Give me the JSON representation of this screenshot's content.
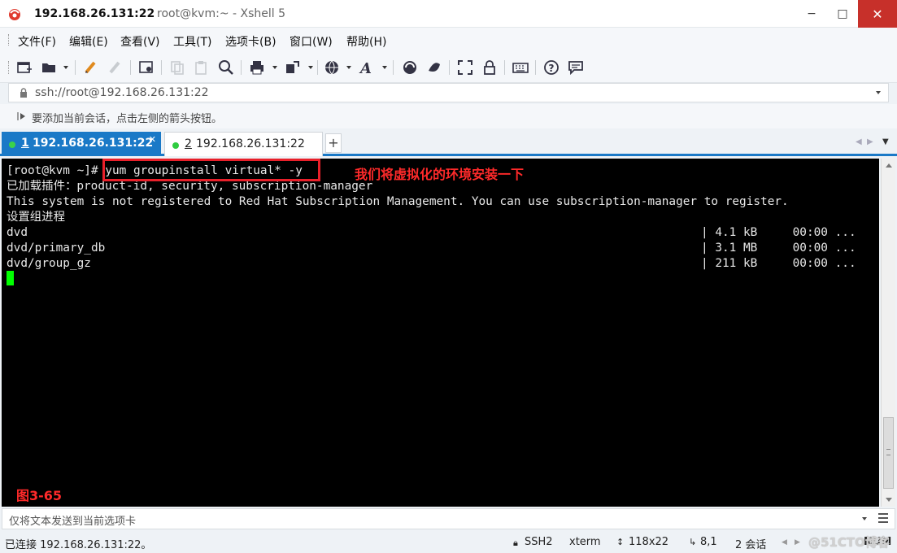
{
  "window": {
    "title_host": "192.168.26.131:22",
    "title_rest": "root@kvm:~ - Xshell 5",
    "minimize": "−",
    "maximize": "□",
    "close": "✕"
  },
  "menu": [
    {
      "label": "文件(F)"
    },
    {
      "label": "编辑(E)"
    },
    {
      "label": "查看(V)"
    },
    {
      "label": "工具(T)"
    },
    {
      "label": "选项卡(B)"
    },
    {
      "label": "窗口(W)"
    },
    {
      "label": "帮助(H)"
    }
  ],
  "toolbar_icons": [
    "new-session-icon",
    "open-folder-icon",
    "reconnect-icon",
    "disconnect-icon",
    "properties-icon",
    "copy-icon",
    "paste-icon",
    "find-icon",
    "print-icon",
    "transfer-icon",
    "globe-icon",
    "font-icon",
    "xftp-icon",
    "xmanager-icon",
    "fullscreen-icon",
    "lock-icon",
    "keyboard-icon",
    "help-icon",
    "chat-icon"
  ],
  "address": {
    "value": "ssh://root@192.168.26.131:22"
  },
  "hint": {
    "text": "要添加当前会话，点击左侧的箭头按钮。"
  },
  "tabs": [
    {
      "num": "1",
      "label": "192.168.26.131:22",
      "active": true
    },
    {
      "num": "2",
      "label": "192.168.26.131:22",
      "active": false
    }
  ],
  "tab_add": "+",
  "terminal": {
    "prompt_line": "[root@kvm ~]# yum groupinstall virtual* -y",
    "lines": [
      "已加载插件：product-id, security, subscription-manager",
      "This system is not registered to Red Hat Subscription Management. You can use subscription-manager to register.",
      "设置组进程",
      "dvd",
      "dvd/primary_db",
      "dvd/group_gz"
    ],
    "right_columns": [
      "| 4.1 kB     00:00 ...",
      "| 3.1 MB     00:00 ...",
      "| 211 kB     00:00 ..."
    ],
    "annotation": "我们将虚拟化的环境安装一下",
    "figure_label": "图3-65",
    "cursor_color": "#00ff00"
  },
  "compose": {
    "placeholder": "仅将文本发送到当前选项卡"
  },
  "status": {
    "connection": "已连接 192.168.26.131:22。",
    "protocol": "SSH2",
    "term": "xterm",
    "size": "118x22",
    "cursor_pos": "8,1",
    "sessions": "2 会话",
    "num": "NUM",
    "watermark": "@51CTO博客"
  },
  "colors": {
    "accent": "#1a79c7",
    "annotation_red": "#ff2a2a",
    "close_button": "#c7302a",
    "terminal_bg": "#000000"
  }
}
